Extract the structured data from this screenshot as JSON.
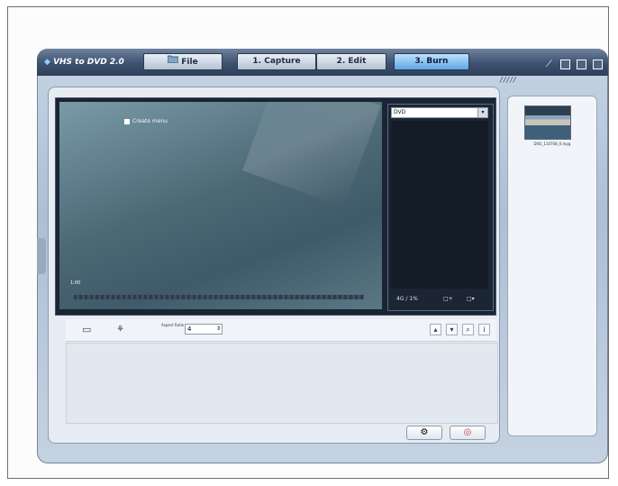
{
  "window": {
    "logo": "VHS to DVD 2.0"
  },
  "tabs": [
    {
      "label": "File",
      "icon": "folder-icon",
      "active": false
    },
    {
      "label": "1. Capture",
      "icon": "",
      "active": false
    },
    {
      "label": "2. Edit",
      "icon": "",
      "active": false
    },
    {
      "label": "3. Burn",
      "icon": "",
      "active": true
    }
  ],
  "preview": {
    "checkbox_label": "Create menu",
    "counter": "1:00"
  },
  "dvd_panel": {
    "format_value": "DVD",
    "size_label": "4G / 1%",
    "add_label": "+",
    "options_label": "▾"
  },
  "toolbar": {
    "ratio_label": "Aspect Ratio",
    "ratio_value": "4"
  },
  "media_library": {
    "thumbnail_label": "DVD_110708_0.mpg"
  },
  "colors": {
    "accent": "#5ea5e6",
    "titlebar": "#3d5170",
    "preview_bg": "#4d6976"
  }
}
